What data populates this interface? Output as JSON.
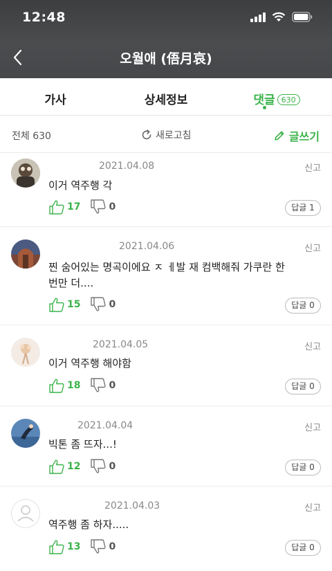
{
  "status_bar": {
    "time": "12:48"
  },
  "nav": {
    "title": "오월애 (俉月哀)"
  },
  "tabs": [
    {
      "label": "가사"
    },
    {
      "label": "상세정보"
    },
    {
      "label": "댓글",
      "count": "630"
    }
  ],
  "toolbar": {
    "total": "전체 630",
    "refresh": "새로고침",
    "write": "글쓰기"
  },
  "comments": [
    {
      "date": "2021.04.08",
      "text": "이거 역주행 각",
      "likes": "17",
      "dislikes": "0",
      "reply": "답글 1",
      "report": "신고"
    },
    {
      "date": "2021.04.06",
      "text": "찐 숨어있는 명곡이에요  ㅈ ㅔ발 재 컴백해줘  가쿠란 한번만 더....",
      "likes": "15",
      "dislikes": "0",
      "reply": "답글 0",
      "report": "신고"
    },
    {
      "date": "2021.04.05",
      "text": "이거 역주행 해야함",
      "likes": "18",
      "dislikes": "0",
      "reply": "답글 0",
      "report": "신고"
    },
    {
      "date": "2021.04.04",
      "text": "빅톤 좀 뜨자...!",
      "likes": "12",
      "dislikes": "0",
      "reply": "답글 0",
      "report": "신고"
    },
    {
      "date": "2021.04.03",
      "text": "역주행 좀 하자.....",
      "likes": "13",
      "dislikes": "0",
      "reply": "답글 0",
      "report": "신고"
    }
  ],
  "colors": {
    "accent": "#3bb34a",
    "header_bg": "#444648"
  }
}
